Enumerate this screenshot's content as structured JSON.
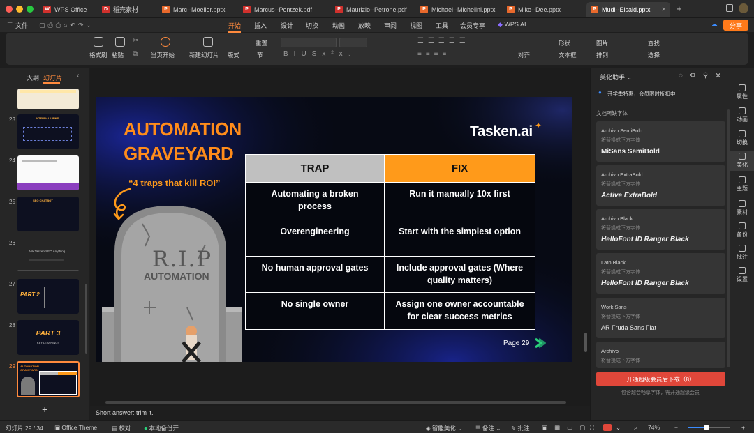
{
  "tabs": [
    {
      "label": "WPS Office",
      "color": "#d0312d",
      "glyph": "W"
    },
    {
      "label": "稻壳素材",
      "color": "#d0312d",
      "glyph": "D"
    },
    {
      "label": "Marc--Moeller.pptx",
      "color": "#e8692c",
      "glyph": "P"
    },
    {
      "label": "Marcus--Pentzek.pdf",
      "color": "#d0312d",
      "glyph": "P"
    },
    {
      "label": "Maurizio--Petrone.pdf",
      "color": "#d0312d",
      "glyph": "P"
    },
    {
      "label": "Michael--Michelini.pptx",
      "color": "#e8692c",
      "glyph": "P"
    },
    {
      "label": "Mike--Dee.pptx",
      "color": "#e8692c",
      "glyph": "P"
    },
    {
      "label": "Mudi--Elsaid.pptx",
      "color": "#e8692c",
      "glyph": "P"
    }
  ],
  "menu": {
    "file": "文件",
    "items": [
      "开始",
      "插入",
      "设计",
      "切换",
      "动画",
      "放映",
      "审阅",
      "视图",
      "工具",
      "会员专享"
    ],
    "wps_ai": "WPS AI",
    "share": "分享"
  },
  "ribbon": {
    "format_painter": "格式刷",
    "paste": "粘贴",
    "from_current": "当页开始",
    "new_slide": "新建幻灯片",
    "layout": "版式",
    "section": "节",
    "reset": "重置",
    "align": "对齐",
    "shape": "形状",
    "picture": "图片",
    "find": "查找",
    "textbox": "文本框",
    "arrange": "排列",
    "select": "选择"
  },
  "left_panel": {
    "tab_outline": "大纲",
    "tab_slides": "幻灯片",
    "thumb_numbers": [
      "23",
      "24",
      "25",
      "26",
      "27",
      "28",
      "29"
    ],
    "thumb26_text": "Ask Tasken SEO Anything",
    "thumb23_title": "INTERNAL LINKS",
    "thumb25_title": "SEO CHATBOT",
    "thumb27_title": "PART 2",
    "thumb28_title": "PART 3",
    "thumb28_sub": "KEY LEARNINGS",
    "thumb29_title": "AUTOMATION GRAVEYARD"
  },
  "slide": {
    "title_line1": "AUTOMATION",
    "title_line2": "GRAVEYARD",
    "quote": "“4 traps that kill ROI”",
    "logo": "Tasken.ai",
    "tomb_rip": "R.I.P",
    "tomb_text": "AUTOMATION",
    "page": "Page 29",
    "table_headers": [
      "TRAP",
      "FIX"
    ],
    "table_rows": [
      [
        "Automating a broken process",
        "Run it manually 10x first"
      ],
      [
        "Overengineering",
        "Start with the simplest option"
      ],
      [
        "No human approval gates",
        "Include approval gates (Where quality matters)"
      ],
      [
        "No single owner",
        "Assign one owner accountable for clear success metrics"
      ]
    ],
    "header_colors": {
      "trap": "#c0c0c0",
      "fix": "#ff9a1a"
    },
    "title_color": "#ff8c1a"
  },
  "notes": "Short answer: trim it.",
  "right_panel": {
    "title": "美化助手",
    "promo": "开学季特惠，会员限时折扣中",
    "section": "文档所缺字体",
    "fonts": [
      {
        "name": "Archivo SemiBold",
        "sub": "将替换成下方字体",
        "preview": "MiSans SemiBold"
      },
      {
        "name": "Archivo ExtraBold",
        "sub": "将替换成下方字体",
        "preview": "Active ExtraBold"
      },
      {
        "name": "Archivo Black",
        "sub": "将替换成下方字体",
        "preview": "HelloFont ID Ranger Black"
      },
      {
        "name": "Lato Black",
        "sub": "将替换成下方字体",
        "preview": "HelloFont ID Ranger Black"
      },
      {
        "name": "Work Sans",
        "sub": "将替换成下方字体",
        "preview": "AR Fruda Sans Flat"
      },
      {
        "name": "Archivo",
        "sub": "将替换成下方字体",
        "preview": ""
      }
    ],
    "download_btn": "开通超级会员后下载（8）",
    "footnote": "包含超会畅享字体，需开通超级会员"
  },
  "sidebar": [
    "属性",
    "动画",
    "切换",
    "美化",
    "主题",
    "素材",
    "备份",
    "批注",
    "设置"
  ],
  "status": {
    "slide_count": "幻灯片 29 / 34",
    "theme": "Office Theme",
    "proof": "校对",
    "backup": "本地备份开",
    "beautify": "智能美化",
    "notes": "备注",
    "comments": "批注",
    "zoom": "74%"
  }
}
